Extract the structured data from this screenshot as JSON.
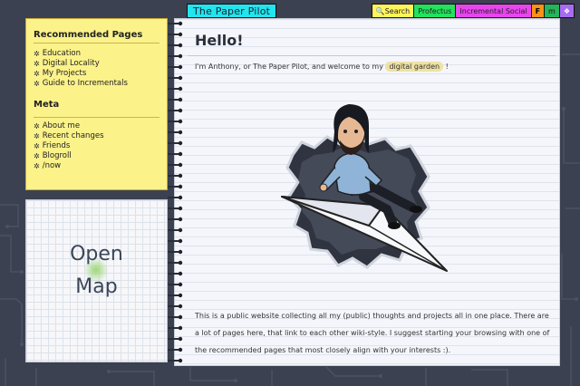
{
  "header": {
    "site_title": "The Paper Pilot",
    "nav": [
      {
        "label": "🔍Search",
        "icon": "search-icon"
      },
      {
        "label": "Profectus"
      },
      {
        "label": "Incremental Social"
      },
      {
        "label": "F"
      },
      {
        "label": "m"
      },
      {
        "label": "❖"
      }
    ]
  },
  "sidebar": {
    "recommended_title": "Recommended Pages",
    "recommended_items": [
      "Education",
      "Digital Locality",
      "My Projects",
      "Guide to Incrementals"
    ],
    "meta_title": "Meta",
    "meta_items": [
      "About me",
      "Recent changes",
      "Friends",
      "Blogroll",
      "/now"
    ]
  },
  "map": {
    "line1": "Open",
    "line2": "Map"
  },
  "main": {
    "title": "Hello!",
    "intro_before": "I'm Anthony, or The Paper Pilot, and welcome to my",
    "intro_link": "digital garden",
    "intro_after": "!",
    "paragraph": "This is a public website collecting all my (public) thoughts and projects all in one place. There are a lot of pages here, that link to each other wiki-style. I suggest starting your browsing with one of the recommended pages that most closely align with your interests :)."
  }
}
